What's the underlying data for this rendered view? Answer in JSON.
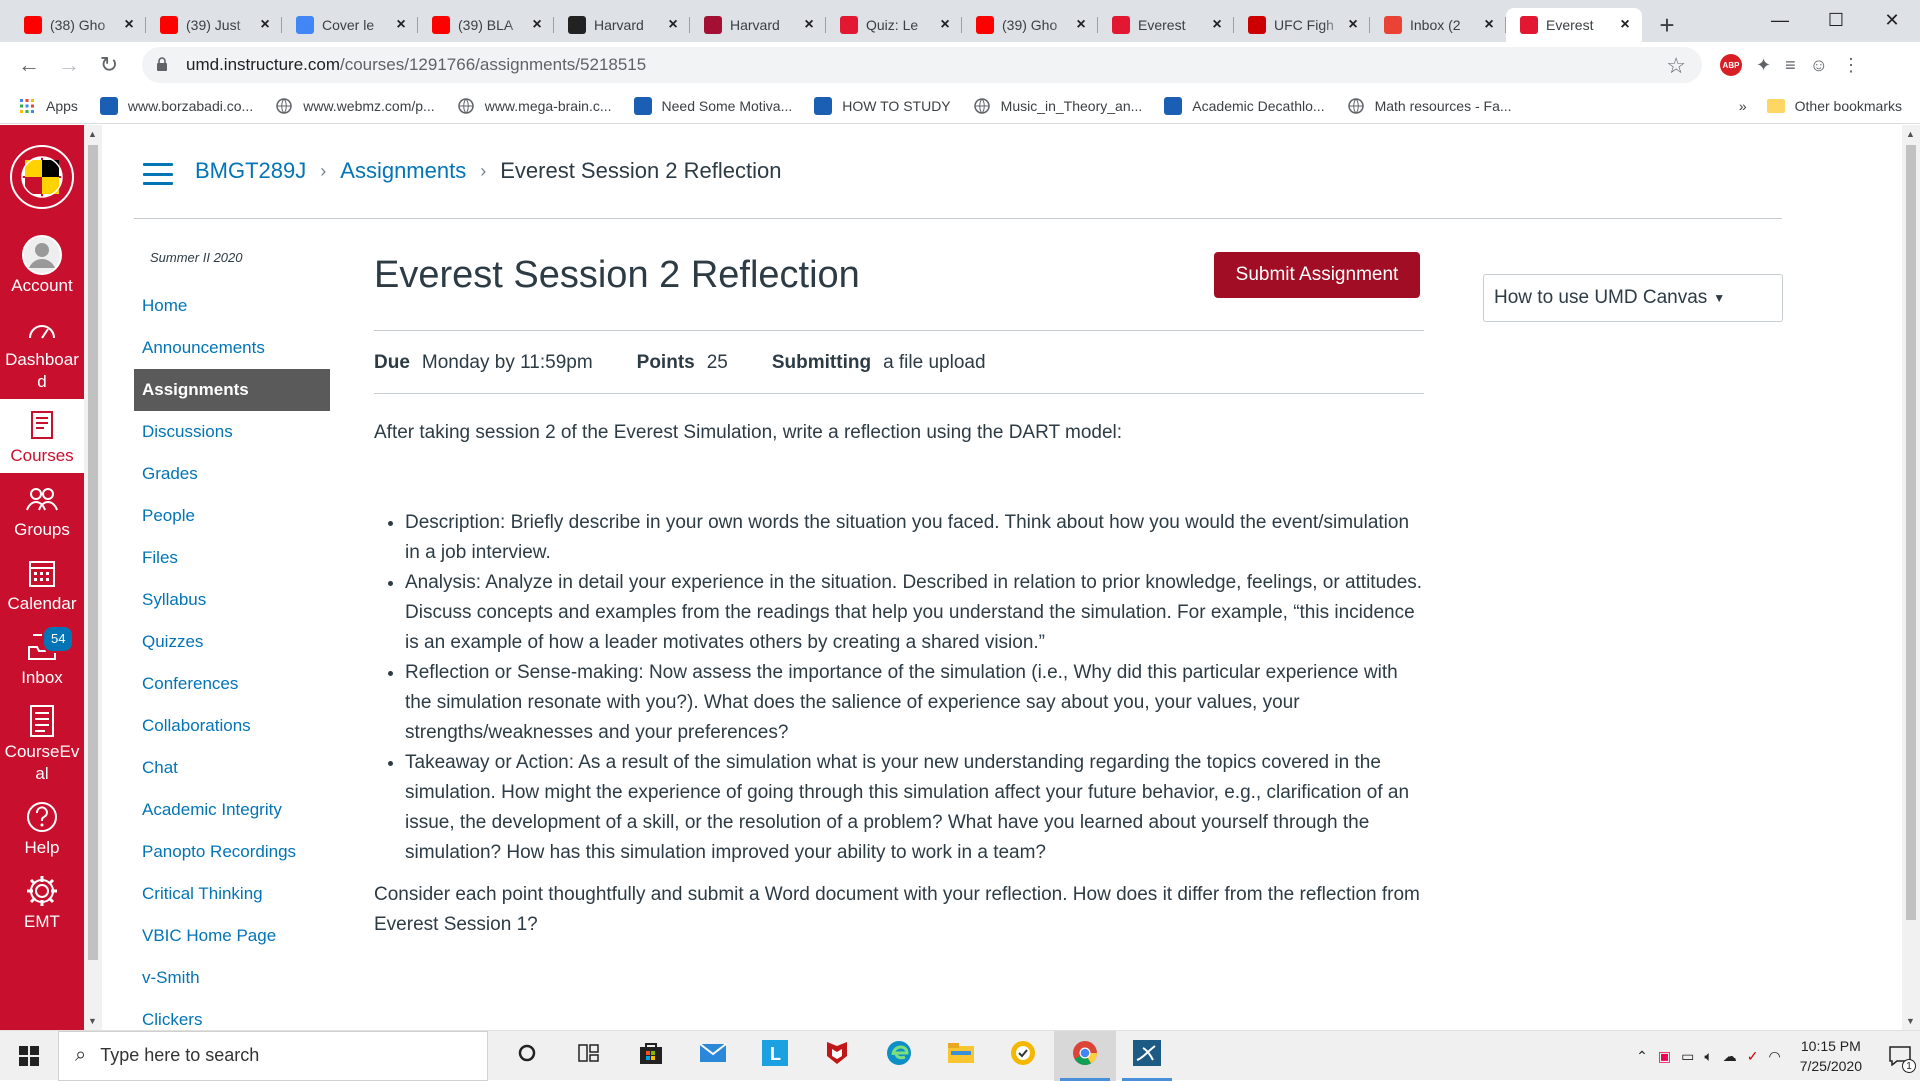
{
  "browser": {
    "tabs": [
      {
        "title": "(38) Gho",
        "favicon": "youtube-icon",
        "color": "#ff0000"
      },
      {
        "title": "(39) Just",
        "favicon": "youtube-icon",
        "color": "#ff0000"
      },
      {
        "title": "Cover le",
        "favicon": "google-docs-icon",
        "color": "#4285f4"
      },
      {
        "title": "(39) BLA",
        "favicon": "youtube-icon",
        "color": "#ff0000"
      },
      {
        "title": "Harvard",
        "favicon": "hbr-icon",
        "color": "#222222"
      },
      {
        "title": "Harvard",
        "favicon": "harvard-shield-icon",
        "color": "#a41034"
      },
      {
        "title": "Quiz: Le",
        "favicon": "umd-icon",
        "color": "#e21833"
      },
      {
        "title": "(39) Gho",
        "favicon": "youtube-icon",
        "color": "#ff0000"
      },
      {
        "title": "Everest",
        "favicon": "umd-icon",
        "color": "#e21833"
      },
      {
        "title": "UFC Figh",
        "favicon": "abc-icon",
        "color": "#cc0000"
      },
      {
        "title": "Inbox (2",
        "favicon": "gmail-icon",
        "color": "#ea4335"
      },
      {
        "title": "Everest",
        "favicon": "umd-icon",
        "color": "#e21833",
        "active": true
      }
    ],
    "new_tab_label": "+",
    "url_host": "umd.instructure.com",
    "url_path": "/courses/1291766/assignments/5218515",
    "extension_abp": "ABP",
    "bookmarks": [
      {
        "label": "Apps",
        "icon": "apps-grid-icon"
      },
      {
        "label": "www.borzabadi.co...",
        "icon": "site-icon"
      },
      {
        "label": "www.webmz.com/p...",
        "icon": "globe-icon"
      },
      {
        "label": "www.mega-brain.c...",
        "icon": "globe-icon"
      },
      {
        "label": "Need Some Motiva...",
        "icon": "site-icon"
      },
      {
        "label": "HOW TO STUDY",
        "icon": "site-icon"
      },
      {
        "label": "Music_in_Theory_an...",
        "icon": "globe-icon"
      },
      {
        "label": "Academic Decathlo...",
        "icon": "site-icon"
      },
      {
        "label": "Math resources - Fa...",
        "icon": "globe-icon"
      }
    ],
    "bookmarks_more": "»",
    "other_bookmarks": "Other bookmarks"
  },
  "global_nav": {
    "items": [
      {
        "label": "Account",
        "icon": "account-icon"
      },
      {
        "label": "Dashboard",
        "icon": "dashboard-icon"
      },
      {
        "label": "Courses",
        "icon": "courses-icon",
        "active": true
      },
      {
        "label": "Groups",
        "icon": "groups-icon"
      },
      {
        "label": "Calendar",
        "icon": "calendar-icon"
      },
      {
        "label": "Inbox",
        "icon": "inbox-icon",
        "badge": "54"
      },
      {
        "label": "CourseEval",
        "icon": "courseeval-icon"
      },
      {
        "label": "Help",
        "icon": "help-icon"
      },
      {
        "label": "EMT",
        "icon": "gear-icon"
      }
    ]
  },
  "breadcrumb": {
    "course": "BMGT289J",
    "section": "Assignments",
    "current": "Everest Session 2 Reflection",
    "separator": "›"
  },
  "course_nav": {
    "term": "Summer II 2020",
    "items": [
      {
        "label": "Home"
      },
      {
        "label": "Announcements"
      },
      {
        "label": "Assignments",
        "active": true
      },
      {
        "label": "Discussions"
      },
      {
        "label": "Grades"
      },
      {
        "label": "People"
      },
      {
        "label": "Files"
      },
      {
        "label": "Syllabus"
      },
      {
        "label": "Quizzes"
      },
      {
        "label": "Conferences"
      },
      {
        "label": "Collaborations"
      },
      {
        "label": "Chat"
      },
      {
        "label": "Academic Integrity"
      },
      {
        "label": "Panopto Recordings"
      },
      {
        "label": "Critical Thinking"
      },
      {
        "label": "VBIC Home Page"
      },
      {
        "label": "v-Smith"
      },
      {
        "label": "Clickers"
      }
    ]
  },
  "assignment": {
    "title": "Everest Session 2 Reflection",
    "submit_label": "Submit Assignment",
    "due_label": "Due",
    "due_value": "Monday by 11:59pm",
    "points_label": "Points",
    "points_value": "25",
    "submitting_label": "Submitting",
    "submitting_value": "a file upload",
    "intro": "After taking session 2 of the Everest Simulation, write a reflection using the DART model:",
    "bullets": [
      "Description: Briefly describe in your own words the situation you faced. Think about how you would the event/simulation in a job interview.",
      "Analysis: Analyze in detail your experience in the situation. Described in relation to prior knowledge, feelings, or attitudes. Discuss concepts and examples from the readings that help you understand the simulation. For example, “this incidence is an example of how a leader motivates others by creating a shared vision.”",
      "Reflection or Sense-making: Now assess the importance of the simulation (i.e., Why did this particular experience with the simulation resonate with you?). What does the salience of experience say about you, your values, your strengths/weaknesses and your preferences?",
      "Takeaway or Action: As a result of the simulation what is your new understanding regarding the topics covered in the simulation. How might the experience of going through this simulation affect your future behavior, e.g., clarification of an issue, the development of a skill, or the resolution of a problem? What have you learned about yourself through the simulation? How has this simulation improved your ability to work in a team?"
    ],
    "outro": "Consider each point thoughtfully and submit a Word document with your reflection. How does it differ from the reflection from Everest Session 1?"
  },
  "aside": {
    "help_menu_label": "How to use UMD Canvas"
  },
  "taskbar": {
    "search_placeholder": "Type here to search",
    "time": "10:15 PM",
    "date": "7/25/2020",
    "notification_count": "1",
    "apps": [
      "cortana-icon",
      "task-view-icon",
      "store-icon",
      "mail-icon",
      "lexia-icon",
      "mcafee-icon",
      "edge-icon",
      "file-explorer-icon",
      "norton-icon",
      "chrome-icon",
      "mysql-icon"
    ]
  },
  "colors": {
    "umd_red": "#c8102e",
    "submit_red": "#a00d24",
    "link_blue": "#0374b5"
  }
}
